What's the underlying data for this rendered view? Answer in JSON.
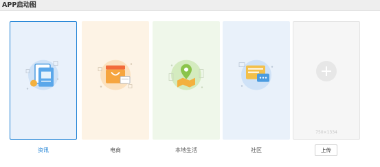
{
  "header": {
    "title": "APP启动图"
  },
  "cards": [
    {
      "key": "zixun",
      "label": "资讯",
      "selected": true,
      "icon": "news-document-icon",
      "accent": "#1a7fd4"
    },
    {
      "key": "dianshang",
      "label": "电商",
      "selected": false,
      "icon": "shop-storefront-icon",
      "accent": "#f2a23a"
    },
    {
      "key": "bendi",
      "label": "本地生活",
      "selected": false,
      "icon": "location-map-icon",
      "accent": "#8ac44a"
    },
    {
      "key": "shequ",
      "label": "社区",
      "selected": false,
      "icon": "chat-community-icon",
      "accent": "#4a9be0"
    }
  ],
  "upload": {
    "size_hint": "750×1334",
    "button_label": "上传"
  },
  "colors": {
    "selected_border": "#1a7fd4",
    "header_bg": "#eeeeee"
  }
}
